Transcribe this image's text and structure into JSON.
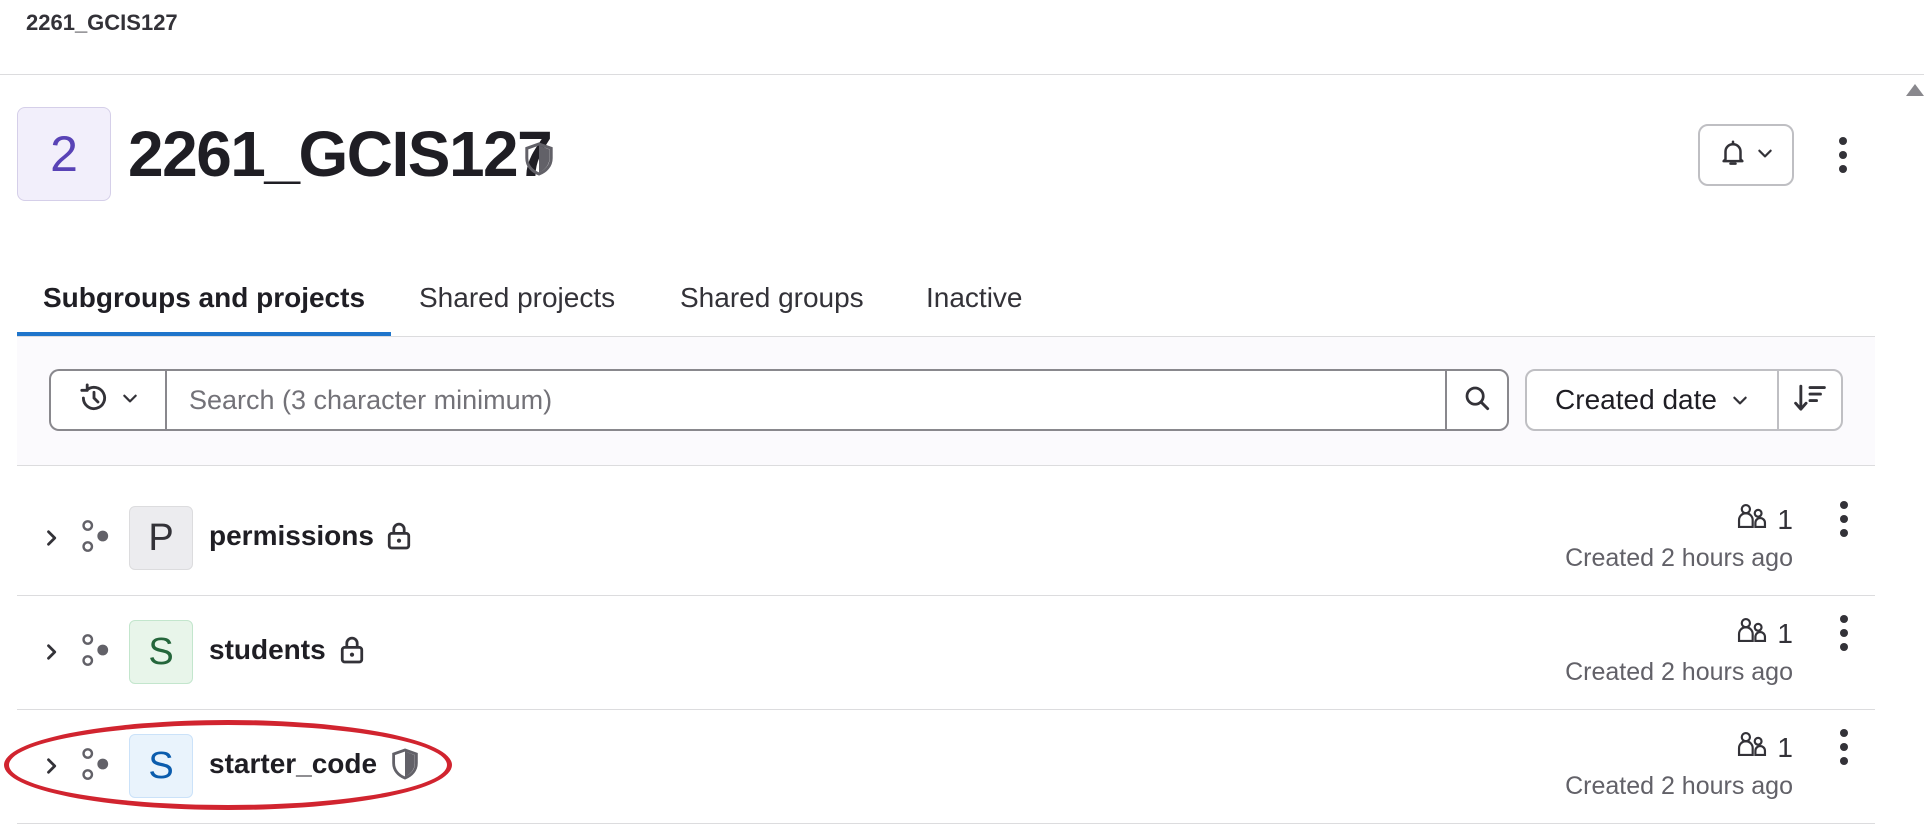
{
  "breadcrumb": "2261_GCIS127",
  "group": {
    "avatar_letter": "2",
    "title": "2261_GCIS127",
    "visibility_icon": "shield-icon"
  },
  "header_actions": {
    "notification_icon": "bell-icon",
    "more_icon": "ellipsis-v-icon"
  },
  "tabs": [
    {
      "label": "Subgroups and projects",
      "active": true
    },
    {
      "label": "Shared projects",
      "active": false
    },
    {
      "label": "Shared groups",
      "active": false
    },
    {
      "label": "Inactive",
      "active": false
    }
  ],
  "filter": {
    "history_icon": "history-icon",
    "search_placeholder": "Search (3 character minimum)",
    "search_value": "",
    "sort_label": "Created date",
    "sort_direction_icon": "sort-lowest-icon"
  },
  "items": [
    {
      "avatar_letter": "P",
      "name": "permissions",
      "visibility": "private",
      "visibility_icon": "lock-icon",
      "members": "1",
      "created": "Created 2 hours ago",
      "avatar_bg": "#ececef",
      "avatar_fg": "#333238",
      "avatar_border": "#dcdcde"
    },
    {
      "avatar_letter": "S",
      "name": "students",
      "visibility": "private",
      "visibility_icon": "lock-icon",
      "members": "1",
      "created": "Created 2 hours ago",
      "avatar_bg": "#e8f5ea",
      "avatar_fg": "#24663b",
      "avatar_border": "#c3e6cd"
    },
    {
      "avatar_letter": "S",
      "name": "starter_code",
      "visibility": "internal",
      "visibility_icon": "shield-icon",
      "members": "1",
      "created": "Created 2 hours ago",
      "avatar_bg": "#e9f3fc",
      "avatar_fg": "#0b5cad",
      "avatar_border": "#cbe2f9"
    }
  ],
  "colors": {
    "accent": "#1f75cb",
    "annotation": "#d1242f"
  }
}
